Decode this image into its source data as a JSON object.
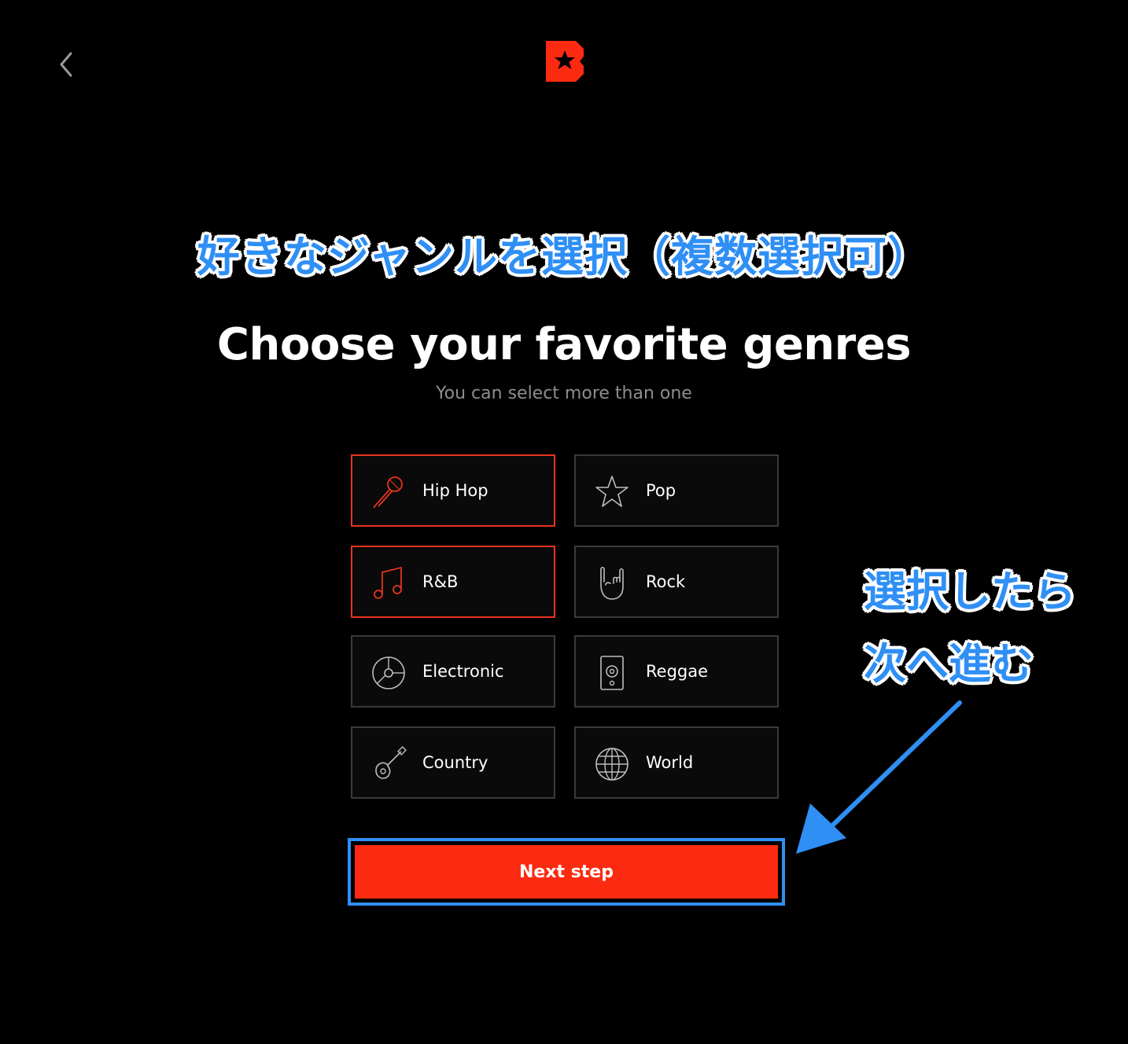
{
  "header": {
    "back_icon": "chevron-left-icon",
    "logo_icon": "beatstars-logo-icon",
    "brand_color": "#fc2a10"
  },
  "annotations": {
    "title_jp": "好きなジャンルを選択（複数選択可）",
    "side_line1": "選択したら",
    "side_line2": "次へ進む",
    "annotation_color": "#2f8ff5"
  },
  "main": {
    "title": "Choose your favorite genres",
    "subtitle": "You can select more than one"
  },
  "genres": [
    {
      "label": "Hip Hop",
      "icon": "microphone-icon",
      "selected": true
    },
    {
      "label": "Pop",
      "icon": "star-icon",
      "selected": false
    },
    {
      "label": "R&B",
      "icon": "music-note-icon",
      "selected": true
    },
    {
      "label": "Rock",
      "icon": "rock-hand-icon",
      "selected": false
    },
    {
      "label": "Electronic",
      "icon": "vinyl-disc-icon",
      "selected": false
    },
    {
      "label": "Reggae",
      "icon": "speaker-icon",
      "selected": false
    },
    {
      "label": "Country",
      "icon": "guitar-icon",
      "selected": false
    },
    {
      "label": "World",
      "icon": "globe-icon",
      "selected": false
    }
  ],
  "footer": {
    "next_label": "Next step"
  }
}
